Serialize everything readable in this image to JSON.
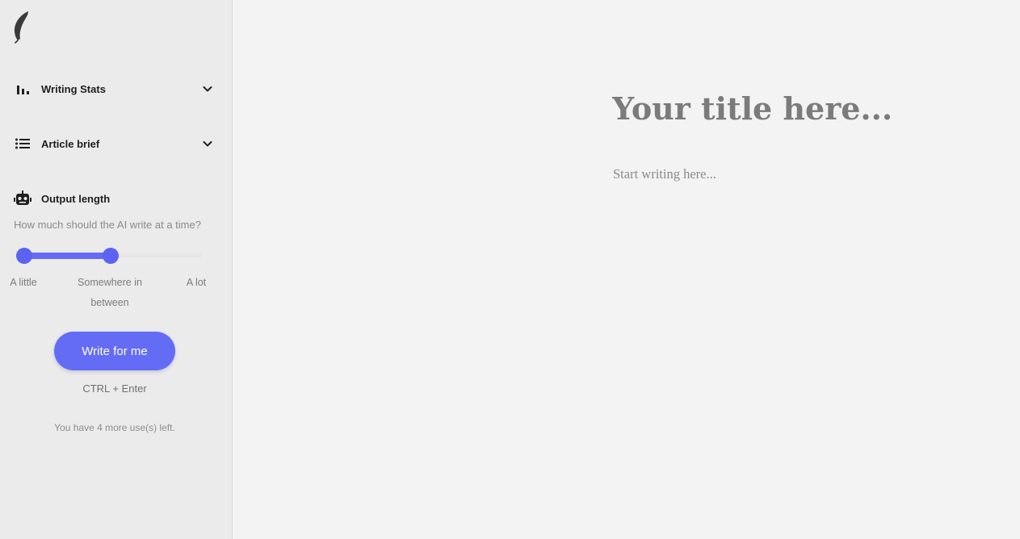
{
  "sidebar": {
    "logo": {
      "icon": "feather-icon"
    },
    "sections": [
      {
        "label": "Writing Stats",
        "icon": "bar-chart-icon",
        "expandable": true
      },
      {
        "label": "Article brief",
        "icon": "list-icon",
        "expandable": true
      }
    ],
    "output_length": {
      "label": "Output length",
      "icon": "robot-icon",
      "question": "How much should the AI write at a time?",
      "options": [
        "A little",
        "Somewhere in between",
        "A lot"
      ],
      "selected_index": 1,
      "selected_fraction": 0.5
    },
    "write_button": {
      "label": "Write for me"
    },
    "shortcut": "CTRL + Enter",
    "uses_left": "You have 4 more use(s) left."
  },
  "editor": {
    "title_placeholder": "Your title here...",
    "body_placeholder": "Start writing here..."
  },
  "colors": {
    "accent": "#646cf6",
    "sidebar_bg": "#ebebeb",
    "page_bg": "#f3f3f3"
  }
}
